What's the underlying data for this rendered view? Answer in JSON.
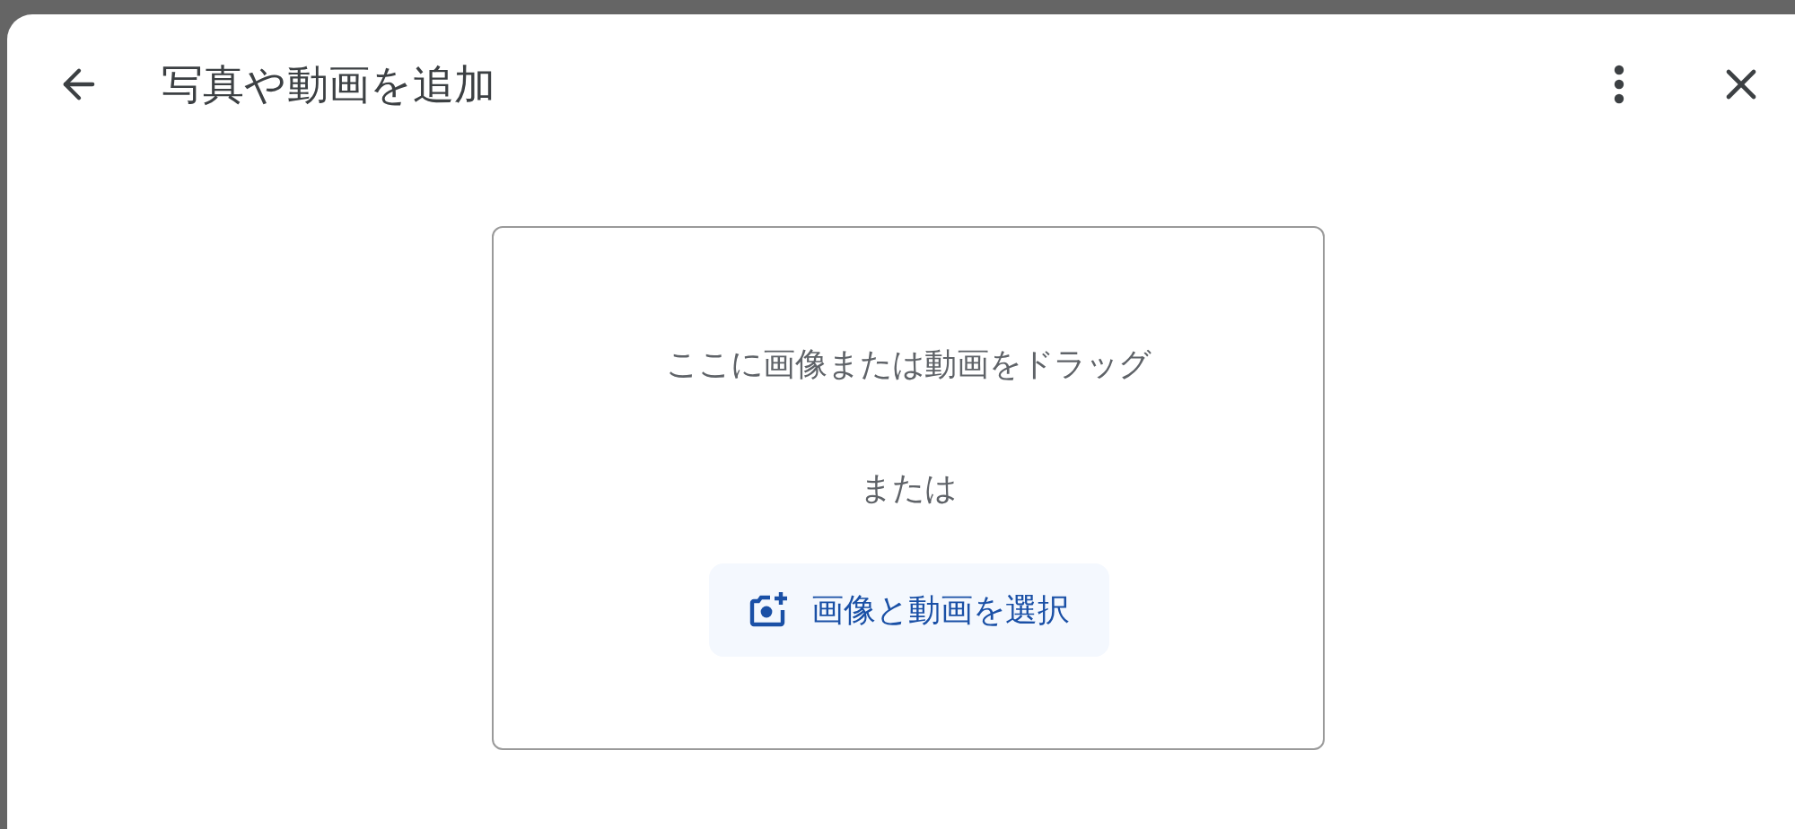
{
  "dialog": {
    "title": "写真や動画を追加"
  },
  "drop_zone": {
    "instruction": "ここに画像または動画をドラッグ",
    "separator": "または",
    "button": "画像と動画を選択"
  }
}
